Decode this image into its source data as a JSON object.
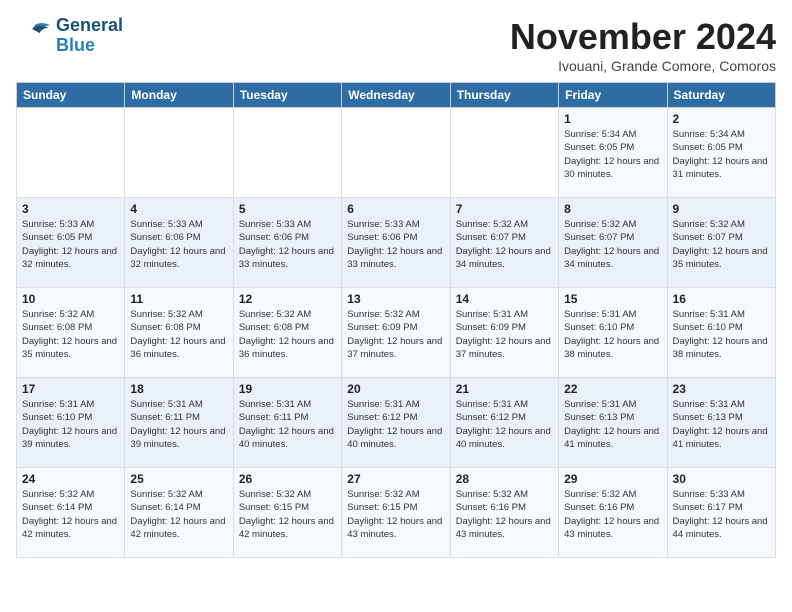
{
  "logo": {
    "line1": "General",
    "line2": "Blue"
  },
  "title": "November 2024",
  "subtitle": "Ivouani, Grande Comore, Comoros",
  "weekdays": [
    "Sunday",
    "Monday",
    "Tuesday",
    "Wednesday",
    "Thursday",
    "Friday",
    "Saturday"
  ],
  "weeks": [
    [
      {
        "day": "",
        "info": ""
      },
      {
        "day": "",
        "info": ""
      },
      {
        "day": "",
        "info": ""
      },
      {
        "day": "",
        "info": ""
      },
      {
        "day": "",
        "info": ""
      },
      {
        "day": "1",
        "info": "Sunrise: 5:34 AM\nSunset: 6:05 PM\nDaylight: 12 hours and 30 minutes."
      },
      {
        "day": "2",
        "info": "Sunrise: 5:34 AM\nSunset: 6:05 PM\nDaylight: 12 hours and 31 minutes."
      }
    ],
    [
      {
        "day": "3",
        "info": "Sunrise: 5:33 AM\nSunset: 6:05 PM\nDaylight: 12 hours and 32 minutes."
      },
      {
        "day": "4",
        "info": "Sunrise: 5:33 AM\nSunset: 6:06 PM\nDaylight: 12 hours and 32 minutes."
      },
      {
        "day": "5",
        "info": "Sunrise: 5:33 AM\nSunset: 6:06 PM\nDaylight: 12 hours and 33 minutes."
      },
      {
        "day": "6",
        "info": "Sunrise: 5:33 AM\nSunset: 6:06 PM\nDaylight: 12 hours and 33 minutes."
      },
      {
        "day": "7",
        "info": "Sunrise: 5:32 AM\nSunset: 6:07 PM\nDaylight: 12 hours and 34 minutes."
      },
      {
        "day": "8",
        "info": "Sunrise: 5:32 AM\nSunset: 6:07 PM\nDaylight: 12 hours and 34 minutes."
      },
      {
        "day": "9",
        "info": "Sunrise: 5:32 AM\nSunset: 6:07 PM\nDaylight: 12 hours and 35 minutes."
      }
    ],
    [
      {
        "day": "10",
        "info": "Sunrise: 5:32 AM\nSunset: 6:08 PM\nDaylight: 12 hours and 35 minutes."
      },
      {
        "day": "11",
        "info": "Sunrise: 5:32 AM\nSunset: 6:08 PM\nDaylight: 12 hours and 36 minutes."
      },
      {
        "day": "12",
        "info": "Sunrise: 5:32 AM\nSunset: 6:08 PM\nDaylight: 12 hours and 36 minutes."
      },
      {
        "day": "13",
        "info": "Sunrise: 5:32 AM\nSunset: 6:09 PM\nDaylight: 12 hours and 37 minutes."
      },
      {
        "day": "14",
        "info": "Sunrise: 5:31 AM\nSunset: 6:09 PM\nDaylight: 12 hours and 37 minutes."
      },
      {
        "day": "15",
        "info": "Sunrise: 5:31 AM\nSunset: 6:10 PM\nDaylight: 12 hours and 38 minutes."
      },
      {
        "day": "16",
        "info": "Sunrise: 5:31 AM\nSunset: 6:10 PM\nDaylight: 12 hours and 38 minutes."
      }
    ],
    [
      {
        "day": "17",
        "info": "Sunrise: 5:31 AM\nSunset: 6:10 PM\nDaylight: 12 hours and 39 minutes."
      },
      {
        "day": "18",
        "info": "Sunrise: 5:31 AM\nSunset: 6:11 PM\nDaylight: 12 hours and 39 minutes."
      },
      {
        "day": "19",
        "info": "Sunrise: 5:31 AM\nSunset: 6:11 PM\nDaylight: 12 hours and 40 minutes."
      },
      {
        "day": "20",
        "info": "Sunrise: 5:31 AM\nSunset: 6:12 PM\nDaylight: 12 hours and 40 minutes."
      },
      {
        "day": "21",
        "info": "Sunrise: 5:31 AM\nSunset: 6:12 PM\nDaylight: 12 hours and 40 minutes."
      },
      {
        "day": "22",
        "info": "Sunrise: 5:31 AM\nSunset: 6:13 PM\nDaylight: 12 hours and 41 minutes."
      },
      {
        "day": "23",
        "info": "Sunrise: 5:31 AM\nSunset: 6:13 PM\nDaylight: 12 hours and 41 minutes."
      }
    ],
    [
      {
        "day": "24",
        "info": "Sunrise: 5:32 AM\nSunset: 6:14 PM\nDaylight: 12 hours and 42 minutes."
      },
      {
        "day": "25",
        "info": "Sunrise: 5:32 AM\nSunset: 6:14 PM\nDaylight: 12 hours and 42 minutes."
      },
      {
        "day": "26",
        "info": "Sunrise: 5:32 AM\nSunset: 6:15 PM\nDaylight: 12 hours and 42 minutes."
      },
      {
        "day": "27",
        "info": "Sunrise: 5:32 AM\nSunset: 6:15 PM\nDaylight: 12 hours and 43 minutes."
      },
      {
        "day": "28",
        "info": "Sunrise: 5:32 AM\nSunset: 6:16 PM\nDaylight: 12 hours and 43 minutes."
      },
      {
        "day": "29",
        "info": "Sunrise: 5:32 AM\nSunset: 6:16 PM\nDaylight: 12 hours and 43 minutes."
      },
      {
        "day": "30",
        "info": "Sunrise: 5:33 AM\nSunset: 6:17 PM\nDaylight: 12 hours and 44 minutes."
      }
    ]
  ]
}
